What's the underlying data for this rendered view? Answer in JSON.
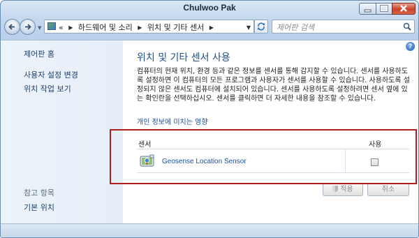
{
  "window": {
    "title": "Chulwoo Pak"
  },
  "address_bar": {
    "prefix": "«",
    "crumbs": [
      "하드웨어 및 소리",
      "위치 및 기타 센서"
    ],
    "search_placeholder": "제어판 검색"
  },
  "sidebar": {
    "links": [
      "제어판 홈",
      "사용자 설정 변경",
      "위치 작업 보기"
    ],
    "see_also_title": "참고 항목",
    "see_also": [
      "기본 위치"
    ]
  },
  "main": {
    "heading": "위치 및 기타 센서 사용",
    "description": "컴퓨터의 현재 위치, 환경 등과 같은 정보를 센서를 통해 감지할 수 있습니다. 센서를 사용하도록 설정하면 이 컴퓨터의 모든 프로그램과 사용자가 센서를 사용할 수 있습니다. 사용하도록 설정되지 않은 센서도 컴퓨터에 설치되어 있습니다. 센서를 사용하도록 설정하려면 센서 옆에 있는 확인란을 선택하십시오. 센서를 클릭하면 더 자세한 내용을 참조할 수 있습니다.",
    "privacy_link": "개인 정보에 미치는 영향",
    "table": {
      "col_sensor": "센서",
      "col_use": "사용",
      "rows": [
        {
          "name": "Geosense Location Sensor",
          "enabled": false
        }
      ]
    },
    "buttons": {
      "apply": "적용",
      "cancel": "취소"
    }
  }
}
